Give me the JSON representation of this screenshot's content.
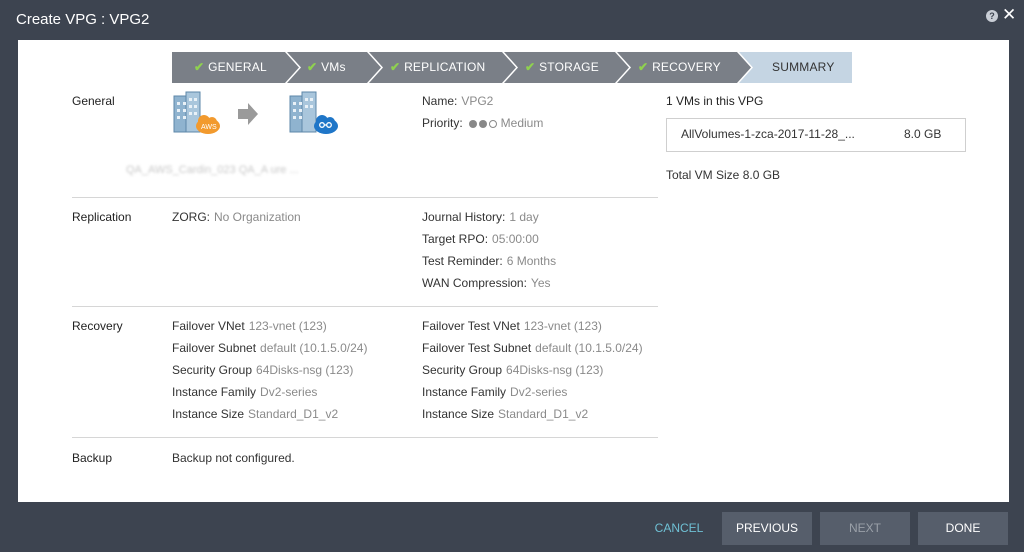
{
  "window": {
    "title": "Create VPG : VPG2",
    "help": "?",
    "close": "✕"
  },
  "wizard": {
    "steps": [
      {
        "label": "GENERAL",
        "done": true
      },
      {
        "label": "VMs",
        "done": true
      },
      {
        "label": "REPLICATION",
        "done": true
      },
      {
        "label": "STORAGE",
        "done": true
      },
      {
        "label": "RECOVERY",
        "done": true
      },
      {
        "label": "SUMMARY",
        "done": false
      }
    ]
  },
  "general": {
    "section": "General",
    "name_label": "Name:",
    "name_value": "VPG2",
    "priority_label": "Priority:",
    "priority_value": "Medium",
    "priority_level": 2,
    "blurred_caption": "QA_AWS_Cardin_023 QA_A      ure        ..."
  },
  "replication": {
    "section": "Replication",
    "zorg_label": "ZORG:",
    "zorg_value": "No Organization",
    "journal_label": "Journal History:",
    "journal_value": "1 day",
    "rpo_label": "Target RPO:",
    "rpo_value": "05:00:00",
    "test_label": "Test Reminder:",
    "test_value": "6 Months",
    "wan_label": "WAN Compression:",
    "wan_value": "Yes"
  },
  "recovery": {
    "section": "Recovery",
    "left": [
      {
        "label": "Failover VNet",
        "value": "123-vnet (123)"
      },
      {
        "label": "Failover Subnet",
        "value": "default (10.1.5.0/24)"
      },
      {
        "label": "Security Group",
        "value": "64Disks-nsg (123)"
      },
      {
        "label": "Instance Family",
        "value": "Dv2-series"
      },
      {
        "label": "Instance Size",
        "value": "Standard_D1_v2"
      }
    ],
    "right": [
      {
        "label": "Failover Test VNet",
        "value": "123-vnet (123)"
      },
      {
        "label": "Failover Test Subnet",
        "value": "default (10.1.5.0/24)"
      },
      {
        "label": "Security Group",
        "value": "64Disks-nsg (123)"
      },
      {
        "label": "Instance Family",
        "value": "Dv2-series"
      },
      {
        "label": "Instance Size",
        "value": "Standard_D1_v2"
      }
    ]
  },
  "backup": {
    "section": "Backup",
    "value": "Backup not configured."
  },
  "vms": {
    "title": "1 VMs in this VPG",
    "items": [
      {
        "name": "AllVolumes-1-zca-2017-11-28_...",
        "size": "8.0 GB"
      }
    ],
    "total": "Total VM Size 8.0 GB"
  },
  "footer": {
    "cancel": "CANCEL",
    "previous": "PREVIOUS",
    "next": "NEXT",
    "done": "DONE"
  },
  "colors": {
    "step_done": "#7a7f87",
    "step_active": "#c5d5e3",
    "check": "#8fd14f",
    "background": "#3d4450",
    "cancel": "#6fc0d4"
  }
}
